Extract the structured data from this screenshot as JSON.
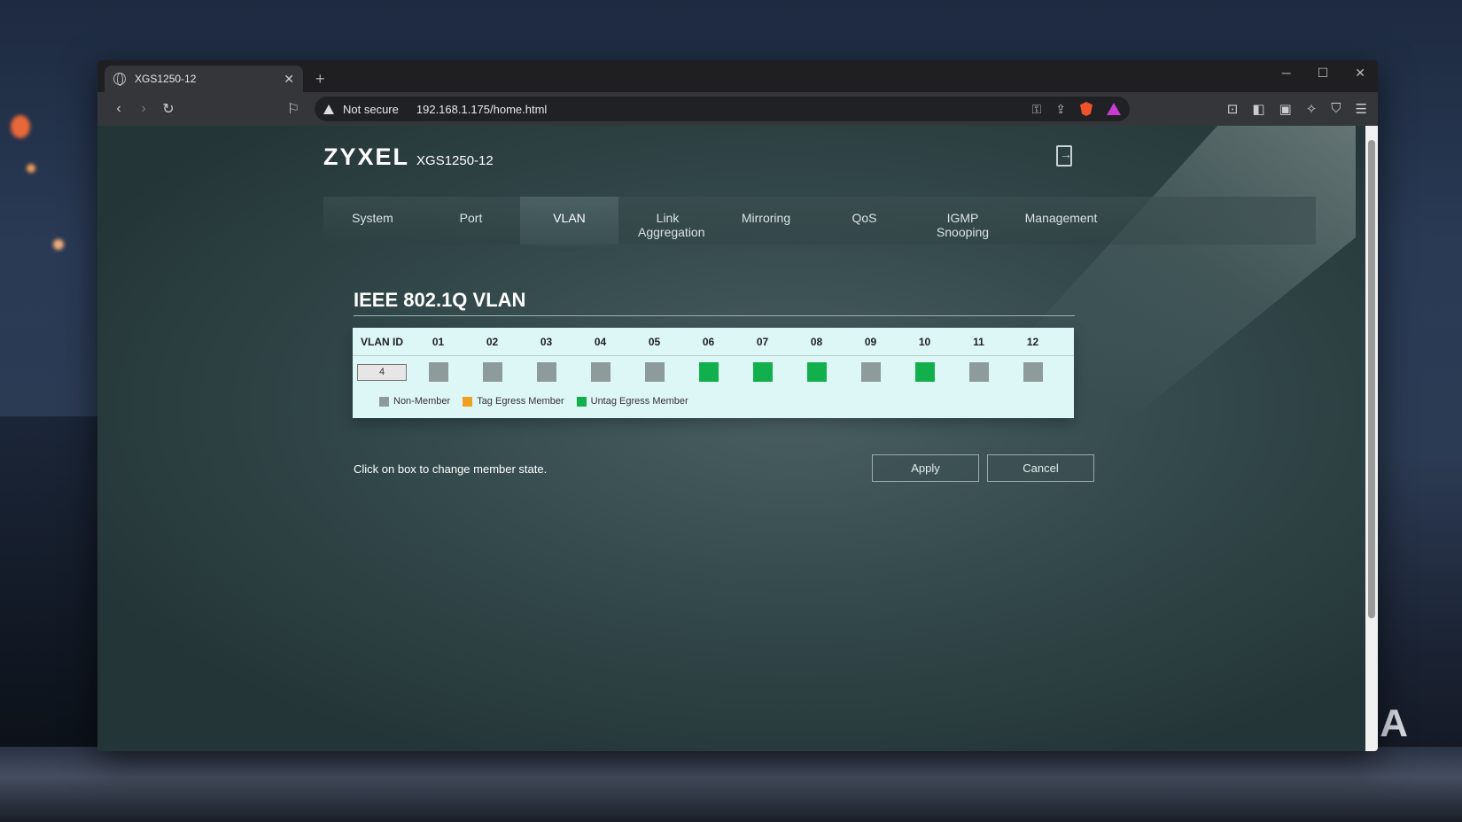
{
  "browser": {
    "tab_title": "XGS1250-12",
    "security_label": "Not secure",
    "url": "192.168.1.175/home.html"
  },
  "header": {
    "brand": "ZYXEL",
    "model": "XGS1250-12"
  },
  "menu": [
    {
      "label": "System",
      "active": false
    },
    {
      "label": "Port",
      "active": false
    },
    {
      "label": "VLAN",
      "active": true
    },
    {
      "label": "Link Aggregation",
      "active": false
    },
    {
      "label": "Mirroring",
      "active": false
    },
    {
      "label": "QoS",
      "active": false
    },
    {
      "label": "IGMP Snooping",
      "active": false
    },
    {
      "label": "Management",
      "active": false
    }
  ],
  "section": {
    "title": "IEEE 802.1Q VLAN"
  },
  "table": {
    "id_header": "VLAN ID",
    "ports": [
      "01",
      "02",
      "03",
      "04",
      "05",
      "06",
      "07",
      "08",
      "09",
      "10",
      "11",
      "12"
    ],
    "vlan_id": "4",
    "states": [
      "non",
      "non",
      "non",
      "non",
      "non",
      "untag",
      "untag",
      "untag",
      "non",
      "untag",
      "non",
      "non"
    ]
  },
  "legend": [
    {
      "key": "non",
      "label": "Non-Member",
      "color": "#8e9b9b"
    },
    {
      "key": "tag",
      "label": "Tag Egress Member",
      "color": "#f0a020"
    },
    {
      "key": "untag",
      "label": "Untag Egress Member",
      "color": "#12b04c"
    }
  ],
  "footer": {
    "hint": "Click on box to change member state.",
    "apply_label": "Apply",
    "cancel_label": "Cancel"
  },
  "watermark": "XDA"
}
